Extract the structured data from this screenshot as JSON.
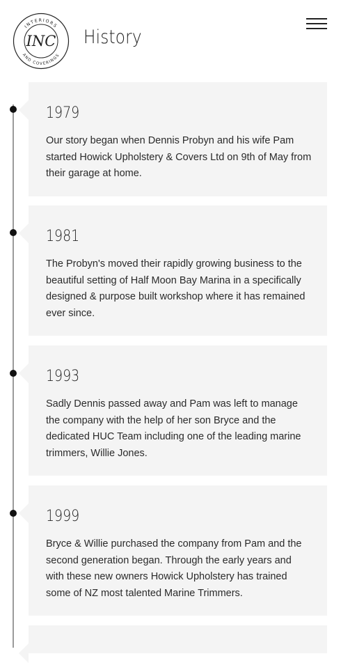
{
  "header": {
    "logo": {
      "top_ring_text": "INTERIORS",
      "bottom_ring_text": "AND COVERINGS",
      "monogram": "INC"
    },
    "title": "History",
    "menu_icon": "hamburger-menu-icon"
  },
  "timeline": {
    "entries": [
      {
        "year": "1979",
        "text": "Our story began when Dennis Probyn and his wife Pam started Howick Upholstery & Covers Ltd on 9th of May from their garage at home."
      },
      {
        "year": "1981",
        "text": "The Probyn's moved their rapidly growing business to the beautiful setting of Half Moon Bay Marina in a specifically designed & purpose built workshop where it has remained ever since."
      },
      {
        "year": "1993",
        "text": "Sadly Dennis passed away and Pam was left to manage the company with the help of her son Bryce and the dedicated HUC Team including one of the leading marine trimmers, Willie Jones."
      },
      {
        "year": "1999",
        "text": "Bryce & Willie purchased the company from Pam and the second generation began. Through the early years and with these new owners Howick Upholstery has trained some of NZ most talented Marine Trimmers."
      }
    ]
  }
}
